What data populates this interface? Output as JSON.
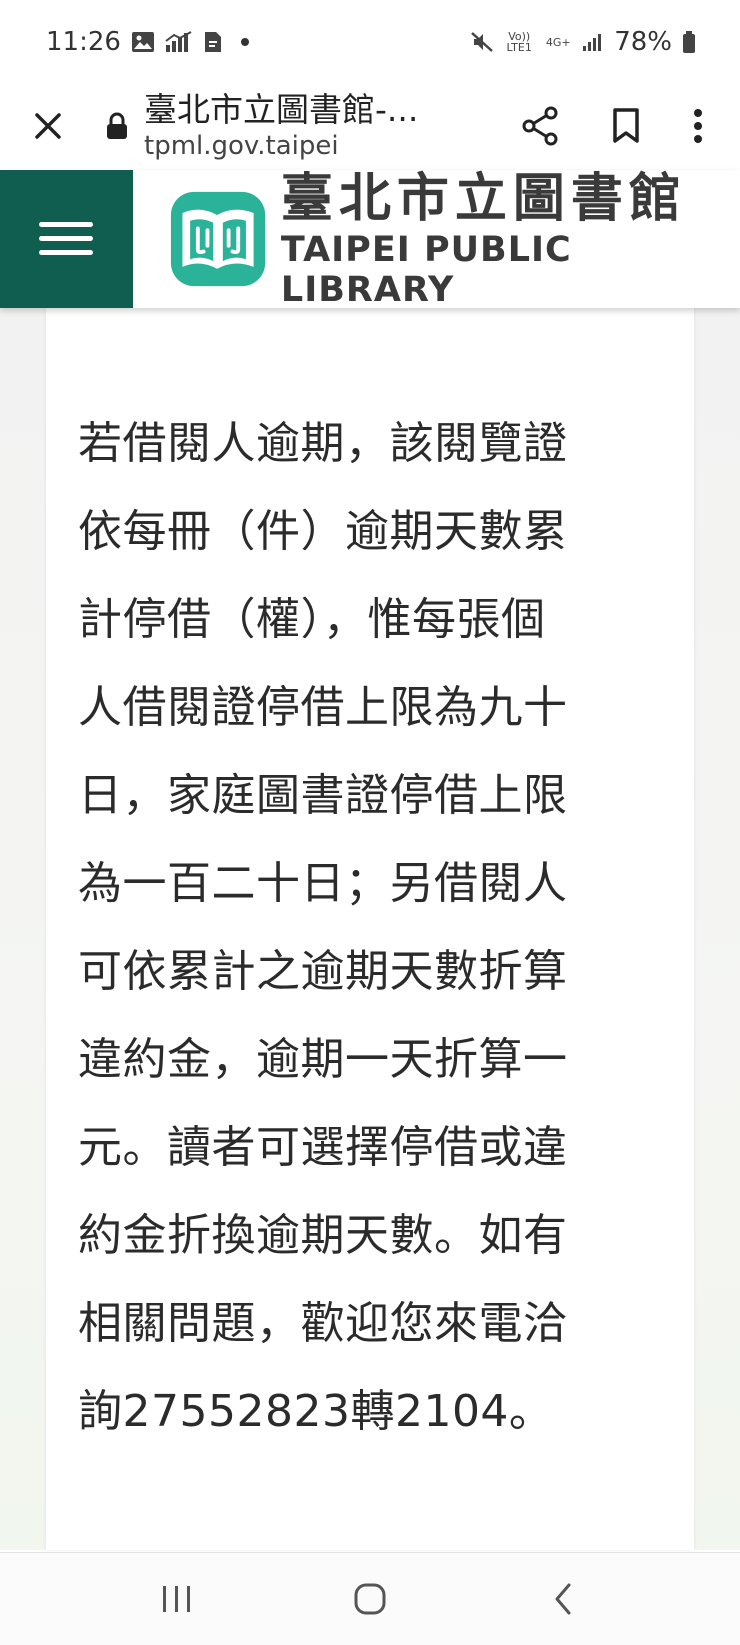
{
  "status_bar": {
    "time": "11:26",
    "volte_label": "Vo)) LTE1",
    "network_label": "4G+",
    "battery": "78%"
  },
  "browser": {
    "tab_title": "臺北市立圖書館-...",
    "domain": "tpml.gov.taipei"
  },
  "site_header": {
    "logo_cn": "臺北市立圖書館",
    "logo_en": "TAIPEI PUBLIC LIBRARY",
    "brand_color": "#0f5e50",
    "logo_color": "#2bb39a"
  },
  "content": {
    "lines": [
      "若借閱人逾期，該閱覽證",
      "依每冊（件）逾期天數累",
      "計停借（權），惟每張個",
      "人借閱證停借上限為九十",
      "日，家庭圖書證停借上限",
      "為一百二十日；另借閱人",
      "可依累計之逾期天數折算",
      "違約金，逾期一天折算一",
      "元。讀者可選擇停借或違",
      "約金折換逾期天數。如有",
      "相關問題，歡迎您來電洽",
      "詢27552823轉2104。"
    ]
  },
  "icons": {
    "status_left": [
      "image-icon",
      "signal-chart-icon",
      "document-icon"
    ],
    "status_right": [
      "mute-icon",
      "signal-bars-icon",
      "battery-icon"
    ],
    "browser": [
      "close-icon",
      "lock-icon",
      "share-icon",
      "bookmark-icon",
      "more-icon"
    ],
    "nav": [
      "recents-icon",
      "home-icon",
      "back-icon"
    ]
  }
}
